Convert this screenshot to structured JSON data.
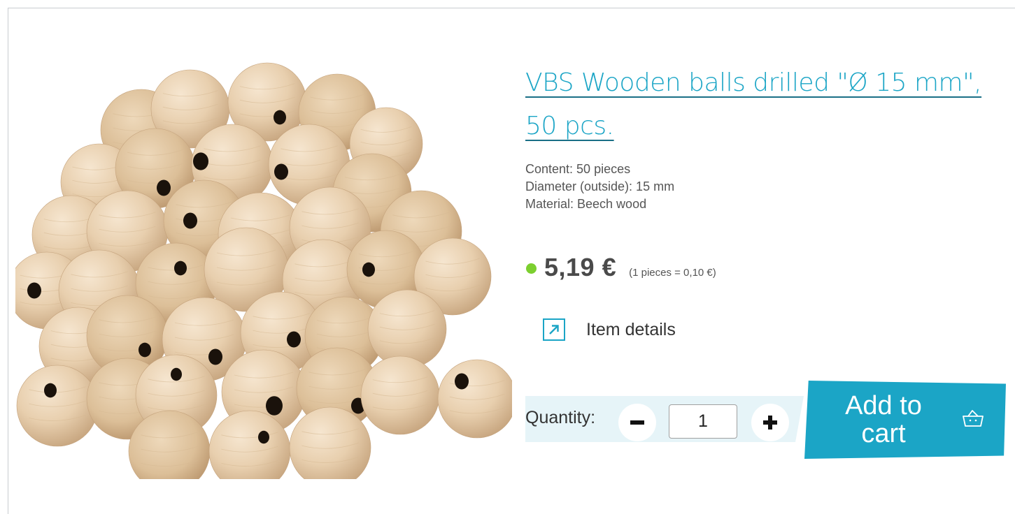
{
  "product": {
    "title": "VBS Wooden balls drilled \"Ø 15 mm\", 50 pcs.",
    "image_icon": "wooden-balls-photo",
    "specs": [
      "Content: 50 pieces",
      "Diameter (outside): 15 mm",
      "Material: Beech wood"
    ],
    "price": "5,19 €",
    "unit_price": "(1 pieces = 0,10 €)",
    "stock_status_color": "#7ccf2f"
  },
  "details_link": {
    "label": "Item details",
    "icon": "external-link-arrow-icon"
  },
  "quantity": {
    "label": "Quantity:",
    "value": "1",
    "minus_icon": "minus-icon",
    "plus_icon": "plus-icon"
  },
  "cart_button": {
    "label": "Add to cart",
    "icon": "basket-icon"
  },
  "colors": {
    "accent": "#1ba5c6",
    "quantity_band": "#e6f4f8",
    "text": "#333333"
  }
}
